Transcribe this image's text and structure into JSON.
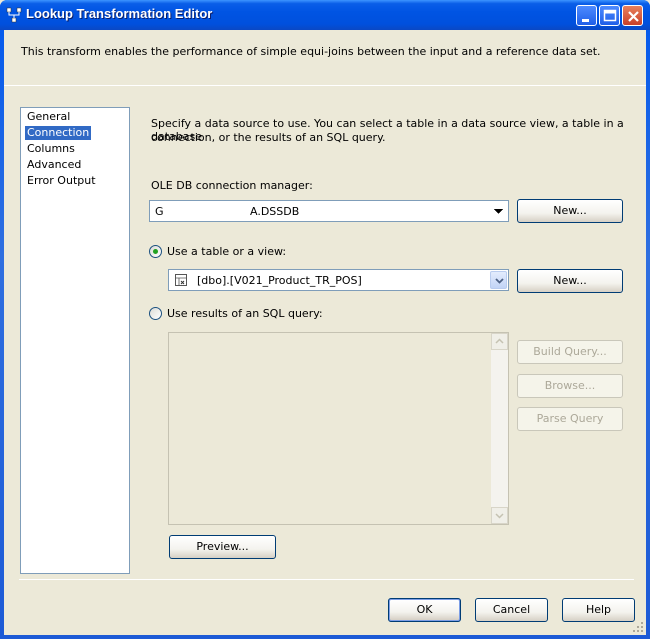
{
  "window": {
    "title": "Lookup Transformation Editor"
  },
  "description": "This transform enables the performance of simple equi-joins between the input and a reference data set.",
  "nav": {
    "items": [
      {
        "label": "General"
      },
      {
        "label": "Connection"
      },
      {
        "label": "Columns"
      },
      {
        "label": "Advanced"
      },
      {
        "label": "Error Output"
      }
    ],
    "selected": "Connection"
  },
  "connection": {
    "instructions_line1": "Specify a data source to use. You can select a table in a data source view, a table in a database",
    "instructions_line2": "connection, or the results of an SQL query.",
    "manager_label": "OLE DB connection manager:",
    "manager_value_prefix": "G",
    "manager_value_suffix": "A.DSSDB",
    "manager_new_button": "New...",
    "use_table_label": "Use a table or a view:",
    "use_table_selected": true,
    "table_value": "[dbo].[V021_Product_TR_POS]",
    "table_new_button": "New...",
    "use_sql_label": "Use results of an SQL query:",
    "sql_text": "",
    "build_query_button": "Build Query...",
    "browse_button": "Browse...",
    "parse_query_button": "Parse Query",
    "preview_button": "Preview..."
  },
  "footer": {
    "ok": "OK",
    "cancel": "Cancel",
    "help": "Help"
  }
}
